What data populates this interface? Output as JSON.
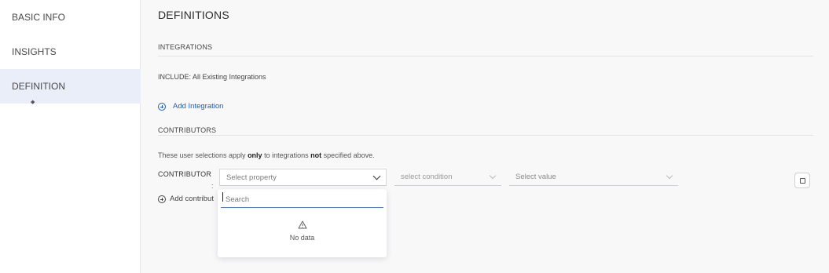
{
  "sidebar": {
    "items": [
      {
        "label": "BASIC INFO"
      },
      {
        "label": "INSIGHTS"
      },
      {
        "label": "DEFINITION"
      }
    ]
  },
  "main": {
    "title": "DEFINITIONS",
    "integrations": {
      "section_title": "INTEGRATIONS",
      "include_text": "INCLUDE: All Existing Integrations",
      "add_label": "Add Integration"
    },
    "contributors": {
      "section_title": "CONTRIBUTORS",
      "helper": {
        "part1": "These user selections apply ",
        "bold1": "only",
        "part2": " to integrations ",
        "bold2": "not",
        "part3": " specified above."
      },
      "row_label": "CONTRIBUTOR",
      "row_colon": ":",
      "property_placeholder": "Select property",
      "condition_placeholder": "select condition",
      "value_placeholder": "Select value",
      "add_label": "Add contribut"
    }
  },
  "dropdown": {
    "search_placeholder": "Search",
    "empty_text": "No data"
  },
  "colors": {
    "accent": "#1f5db8",
    "active_nav_bg": "#e9eef8"
  }
}
